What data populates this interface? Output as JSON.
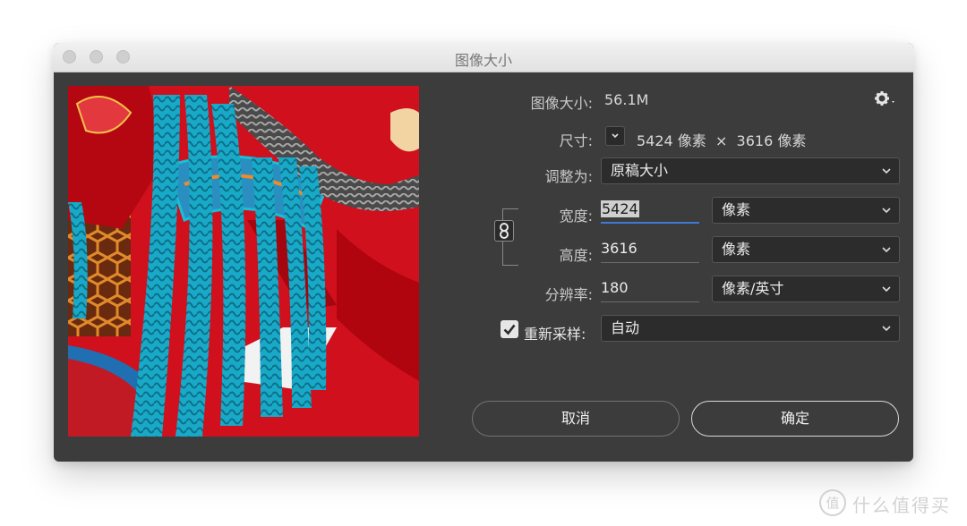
{
  "window": {
    "title": "图像大小"
  },
  "image_size": {
    "label": "图像大小:",
    "value": "56.1M",
    "settings_icon": "gear-icon"
  },
  "dimensions": {
    "label": "尺寸:",
    "value": "5424 像素  ×  3616 像素"
  },
  "fit_to": {
    "label": "调整为:",
    "selected": "原稿大小"
  },
  "width": {
    "label": "宽度:",
    "value": "5424",
    "unit": "像素"
  },
  "height": {
    "label": "高度:",
    "value": "3616",
    "unit": "像素"
  },
  "resolution": {
    "label": "分辨率:",
    "value": "180",
    "unit": "像素/英寸"
  },
  "resample": {
    "label": "重新采样:",
    "checked": true,
    "selected": "自动"
  },
  "buttons": {
    "cancel": "取消",
    "ok": "确定"
  },
  "watermark": {
    "text": "什么值得买",
    "logo": "值"
  },
  "colors": {
    "dialog_bg": "#3c3c3c",
    "field_bg": "#2c2c2c",
    "focus_underline": "#3f79d6",
    "photo_red": "#d0101c",
    "photo_cyan": "#19a9c8"
  }
}
